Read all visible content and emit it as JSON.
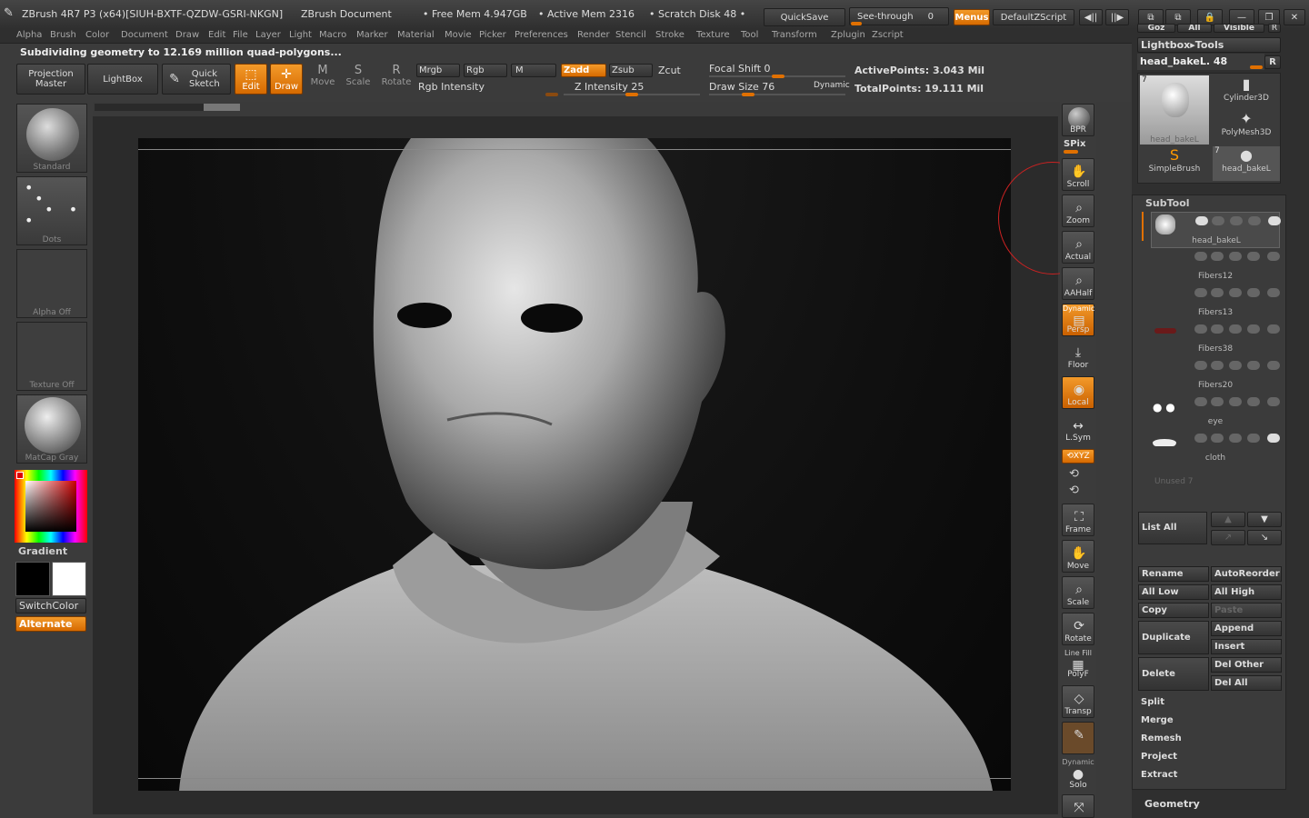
{
  "titlebar": {
    "app_title": "ZBrush 4R7 P3 (x64)[SIUH-BXTF-QZDW-GSRI-NKGN]",
    "document": "ZBrush Document",
    "free_mem": "• Free Mem 4.947GB",
    "active_mem": "• Active Mem 2316",
    "scratch": "• Scratch Disk 48 •",
    "quicksave": "QuickSave",
    "see_through": "See-through",
    "see_through_value": "0",
    "menus": "Menus",
    "default_zscript": "DefaultZScript"
  },
  "menubar": [
    "Alpha",
    "Brush",
    "Color",
    "Document",
    "Draw",
    "Edit",
    "File",
    "Layer",
    "Light",
    "Macro",
    "Marker",
    "Material",
    "Movie",
    "Picker",
    "Preferences",
    "Render",
    "Stencil",
    "Stroke",
    "Texture",
    "Tool",
    "Transform",
    "Zplugin",
    "Zscript"
  ],
  "status": "Subdividing geometry to 12.169 million quad-polygons...",
  "shelf": {
    "projection_master": "Projection Master",
    "lightbox": "LightBox",
    "quick_sketch": "Quick Sketch",
    "edit": "Edit",
    "draw": "Draw",
    "move": "Move",
    "scale": "Scale",
    "rotate": "Rotate",
    "mrgb": "Mrgb",
    "rgb": "Rgb",
    "m": "M",
    "rgb_intensity": "Rgb Intensity",
    "zadd": "Zadd",
    "zsub": "Zsub",
    "zcut": "Zcut",
    "z_intensity": "Z Intensity 25",
    "focal_shift": "Focal Shift 0",
    "draw_size": "Draw Size 76",
    "dynamic": "Dynamic",
    "active_points": "ActivePoints: 3.043 Mil",
    "total_points": "TotalPoints: 19.111 Mil"
  },
  "lefttray": {
    "brush": "Standard",
    "stroke": "Dots",
    "alpha": "Alpha Off",
    "texture": "Texture Off",
    "material": "MatCap Gray",
    "gradient": "Gradient",
    "switchcolor": "SwitchColor",
    "alternate": "Alternate"
  },
  "rightshelf": {
    "bpr": "BPR",
    "spix": "SPix",
    "scroll": "Scroll",
    "zoom": "Zoom",
    "actual": "Actual",
    "aahalf": "AAHalf",
    "persp_dynamic": "Dynamic",
    "persp": "Persp",
    "floor": "Floor",
    "local": "Local",
    "lsym": "L.Sym",
    "xyz": "⟲XYZ",
    "frame": "Frame",
    "move": "Move",
    "scale": "Scale",
    "rotate": "Rotate",
    "polyf_line": "Line Fill",
    "polyf": "PolyF",
    "transp": "Transp",
    "solo_dynamic": "Dynamic",
    "solo": "Solo"
  },
  "righttray": {
    "top_buttons": [
      "Goz",
      "All",
      "Visible",
      "R"
    ],
    "lightbox_tools": "Lightbox▸Tools",
    "current_tool": "head_bakeL. 48",
    "r": "R",
    "tools": [
      {
        "name": "head_bakeL",
        "count": "7"
      },
      {
        "name": "Cylinder3D",
        "count": ""
      },
      {
        "name": "PolyMesh3D",
        "count": ""
      },
      {
        "name": "SimpleBrush",
        "count": ""
      },
      {
        "name": "head_bakeL",
        "count": "7"
      }
    ],
    "subtool_title": "SubTool",
    "subtools": [
      "head_bakeL",
      "Fibers12",
      "Fibers13",
      "Fibers38",
      "Fibers20",
      "eye",
      "cloth"
    ],
    "unused": "Unused 7",
    "list_all": "List All",
    "rename": "Rename",
    "autoreorder": "AutoReorder",
    "all_low": "All Low",
    "all_high": "All High",
    "copy": "Copy",
    "paste": "Paste",
    "duplicate": "Duplicate",
    "append": "Append",
    "insert": "Insert",
    "delete": "Delete",
    "del_other": "Del Other",
    "del_all": "Del All",
    "split": "Split",
    "merge": "Merge",
    "remesh": "Remesh",
    "project": "Project",
    "extract": "Extract",
    "geometry": "Geometry"
  },
  "colors": {
    "accent": "#e07000",
    "panel": "#3b3b3b",
    "canvas": "#0f0f0f"
  }
}
